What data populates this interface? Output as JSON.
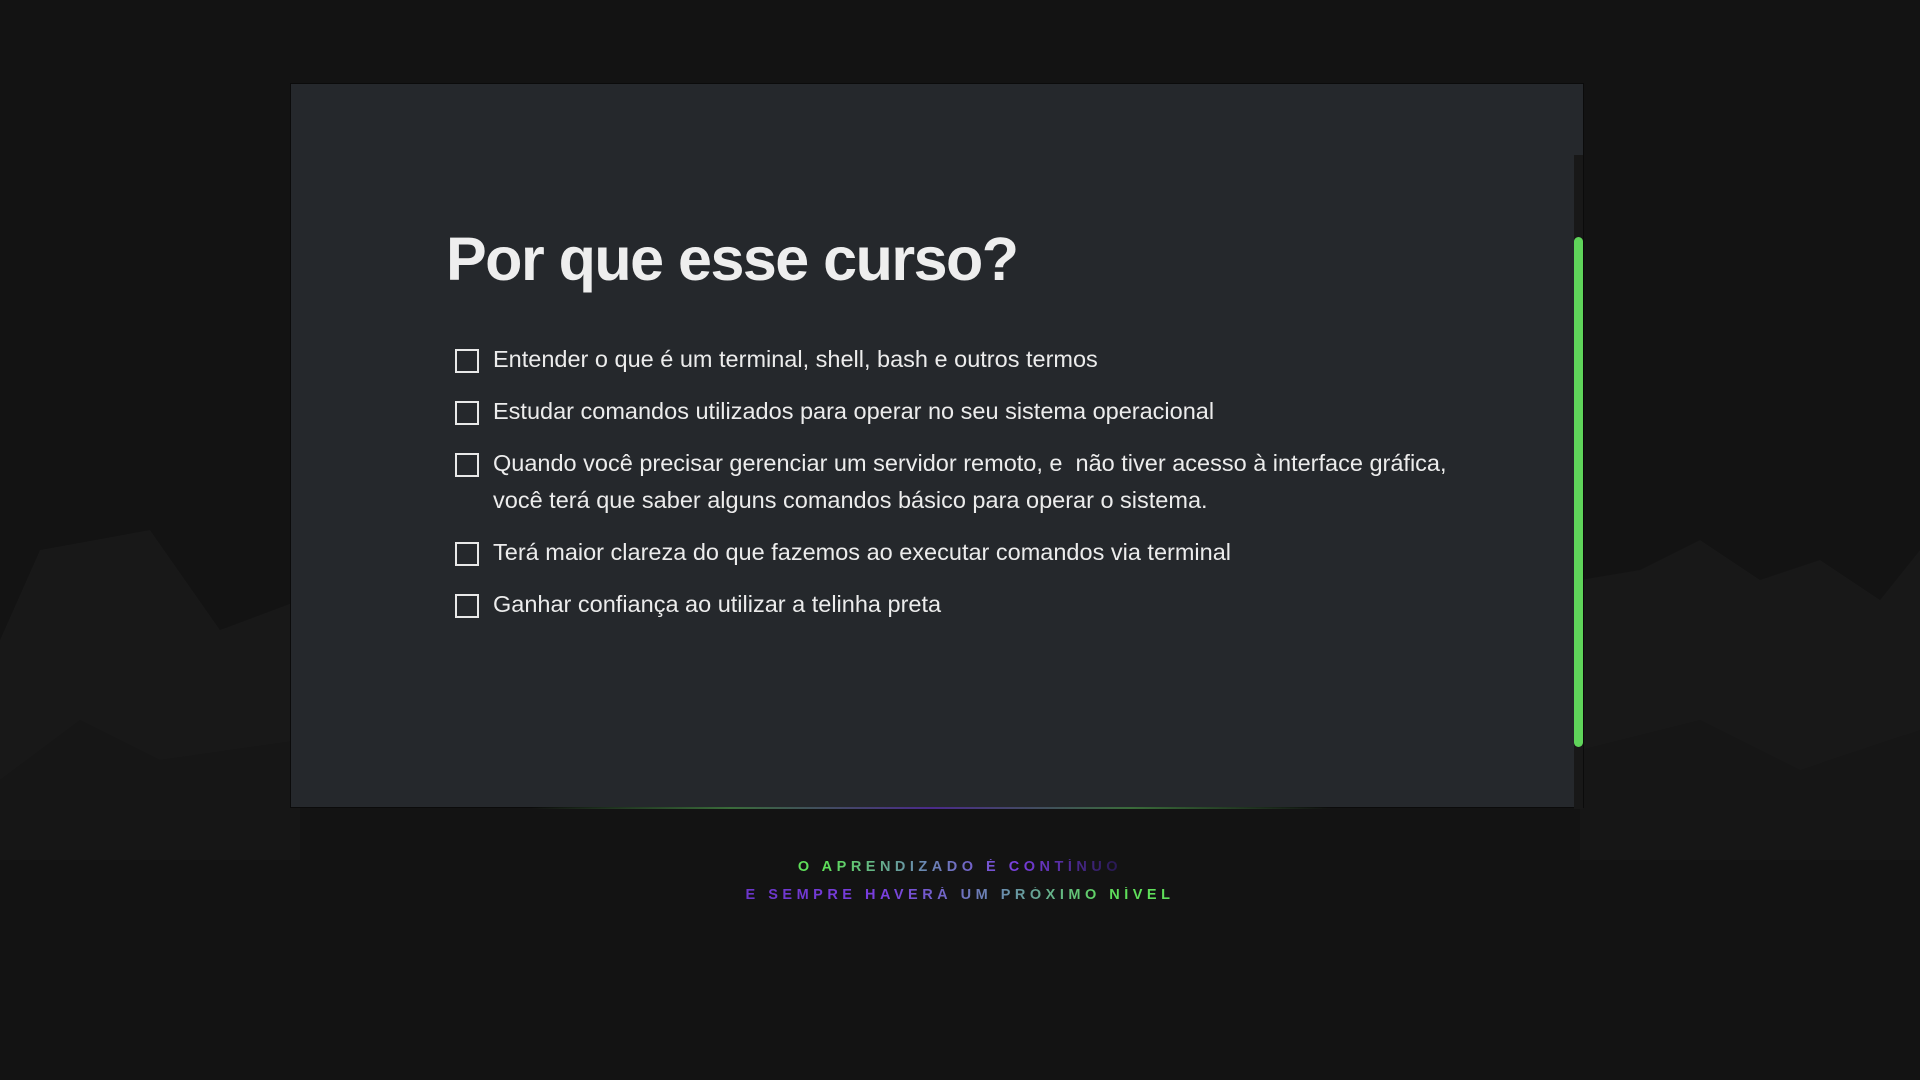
{
  "slide": {
    "title": "Por que esse curso?",
    "items": [
      {
        "label": "Entender o que é um terminal, shell, bash e outros termos",
        "checked": false
      },
      {
        "label": "Estudar comandos utilizados para operar no seu sistema operacional",
        "checked": false
      },
      {
        "label": "Quando você precisar gerenciar um servidor remoto, e  não tiver acesso à interface gráfica, você terá que saber alguns comandos básico para operar o sistema.",
        "checked": false
      },
      {
        "label": "Terá maior clareza do que fazemos ao executar comandos via terminal",
        "checked": false
      },
      {
        "label": "Ganhar confiança ao utilizar a telinha preta",
        "checked": false
      }
    ]
  },
  "footer": {
    "line1": "O APRENDIZADO É CONTÍNUO",
    "line2": "E SEMPRE HAVERÁ UM PRÓXIMO NÍVEL"
  },
  "colors": {
    "accent": "#5fd45a",
    "purple": "#7a3ee0",
    "slide_bg": "#25282c",
    "page_bg": "#131313"
  }
}
